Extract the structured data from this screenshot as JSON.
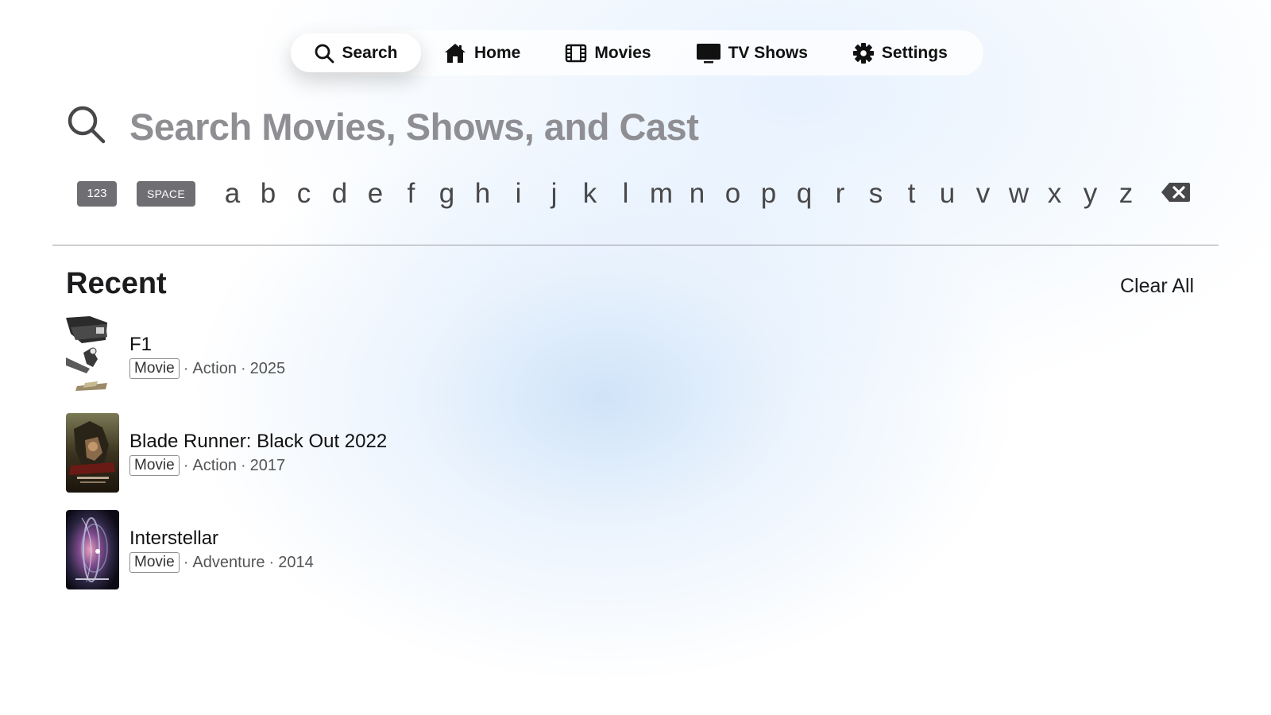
{
  "nav": {
    "items": [
      {
        "label": "Search",
        "icon": "search-icon",
        "active": true
      },
      {
        "label": "Home",
        "icon": "house-icon",
        "active": false
      },
      {
        "label": "Movies",
        "icon": "film-icon",
        "active": false
      },
      {
        "label": "TV Shows",
        "icon": "tv-icon",
        "active": false
      },
      {
        "label": "Settings",
        "icon": "gear-icon",
        "active": false
      }
    ]
  },
  "search": {
    "placeholder": "Search Movies, Shows, and Cast"
  },
  "keyboard": {
    "numbers_label": "123",
    "space_label": "SPACE",
    "letters": [
      "a",
      "b",
      "c",
      "d",
      "e",
      "f",
      "g",
      "h",
      "i",
      "j",
      "k",
      "l",
      "m",
      "n",
      "o",
      "p",
      "q",
      "r",
      "s",
      "t",
      "u",
      "v",
      "w",
      "x",
      "y",
      "z"
    ],
    "backspace_icon": "backspace-icon"
  },
  "recent": {
    "title": "Recent",
    "clear_label": "Clear All",
    "items": [
      {
        "title": "F1",
        "type": "Movie",
        "genre": "Action",
        "year": "2025",
        "sep": "·"
      },
      {
        "title": "Blade Runner: Black Out 2022",
        "type": "Movie",
        "genre": "Action",
        "year": "2017",
        "sep": "·"
      },
      {
        "title": "Interstellar",
        "type": "Movie",
        "genre": "Adventure",
        "year": "2014",
        "sep": "·"
      }
    ]
  },
  "colors": {
    "accent_bg": "#ffffff",
    "key_pill": "#6e6e73",
    "placeholder_text": "#8e8e93"
  }
}
